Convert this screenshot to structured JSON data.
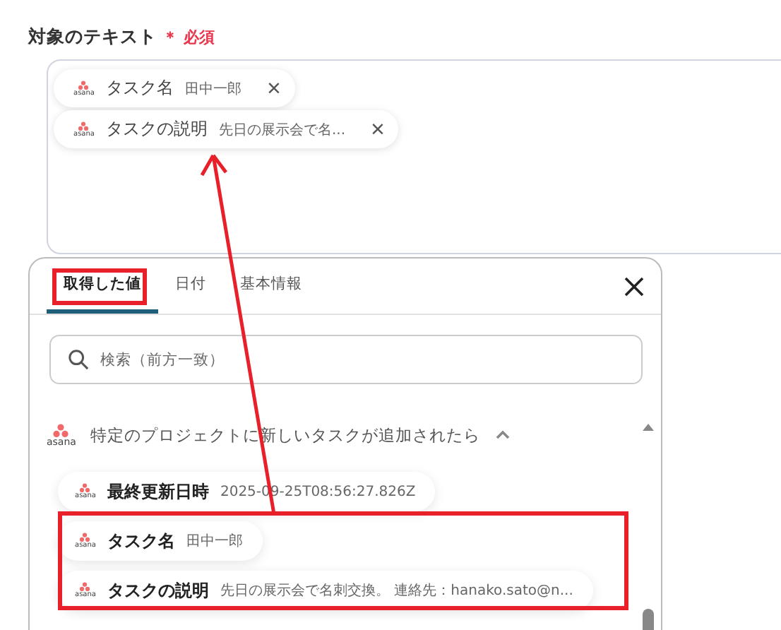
{
  "field": {
    "label": "対象のテキスト",
    "required_mark": "＊",
    "required_text": "必須",
    "chips": [
      {
        "logo": "asana",
        "name": "タスク名",
        "value": "田中一郎",
        "remove": "×"
      },
      {
        "logo": "asana",
        "name": "タスクの説明",
        "value": "先日の展示会で名...",
        "remove": "×"
      }
    ]
  },
  "popup": {
    "tabs": [
      {
        "label": "取得した値",
        "selected": true
      },
      {
        "label": "日付",
        "selected": false
      },
      {
        "label": "基本情報",
        "selected": false
      }
    ],
    "search": {
      "placeholder": "検索（前方一致）"
    },
    "section": {
      "logo": "asana",
      "title": "特定のプロジェクトに新しいタスクが追加されたら",
      "expanded": true
    },
    "items": [
      {
        "logo": "asana",
        "name": "最終更新日時",
        "value": "2025-09-25T08:56:27.826Z"
      },
      {
        "logo": "asana",
        "name": "タスク名",
        "value": "田中一郎"
      },
      {
        "logo": "asana",
        "name": "タスクの説明",
        "value": "先日の展示会で名刺交換。 連絡先：hanako.sato@n..."
      }
    ]
  }
}
